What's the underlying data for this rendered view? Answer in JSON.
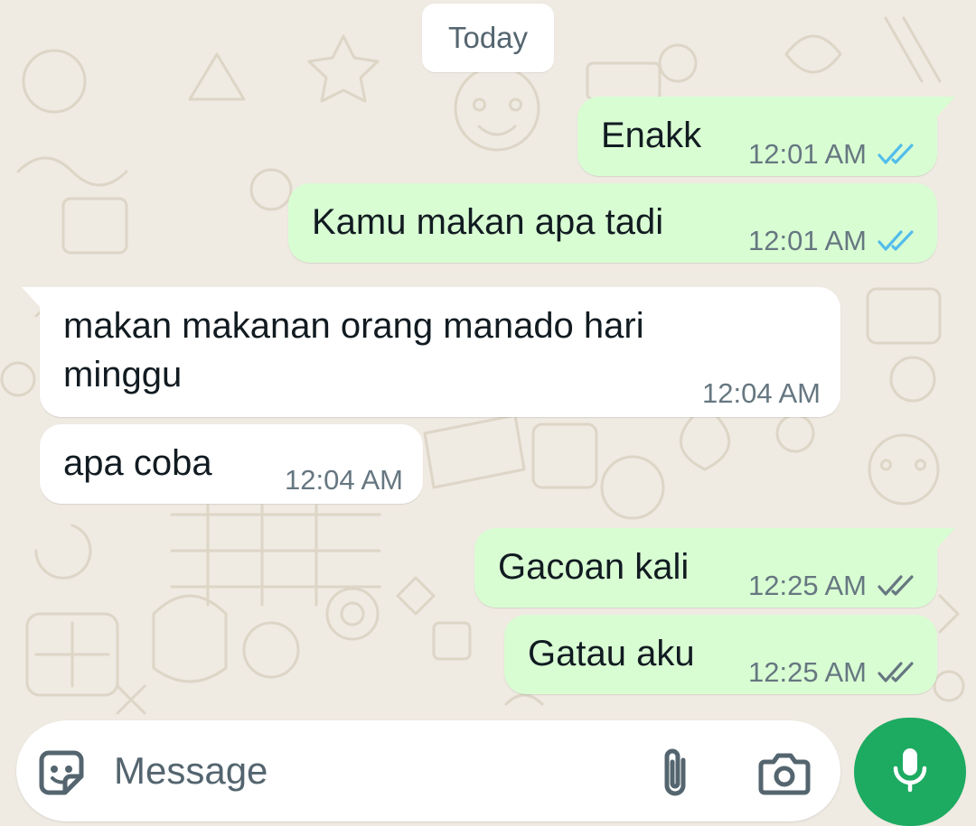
{
  "chat": {
    "date_label": "Today",
    "messages": [
      {
        "direction": "outgoing",
        "text": "Enakk",
        "time": "12:01 AM",
        "status": "read"
      },
      {
        "direction": "outgoing",
        "text": "Kamu makan apa tadi",
        "time": "12:01 AM",
        "status": "read"
      },
      {
        "direction": "incoming",
        "text_line1": "makan makanan orang manado hari",
        "text_line2": "minggu",
        "time": "12:04 AM"
      },
      {
        "direction": "incoming",
        "text": "apa coba",
        "time": "12:04 AM"
      },
      {
        "direction": "outgoing",
        "text": "Gacoan kali",
        "time": "12:25 AM",
        "status": "delivered"
      },
      {
        "direction": "outgoing",
        "text": "Gatau aku",
        "time": "12:25 AM",
        "status": "delivered"
      }
    ]
  },
  "input": {
    "placeholder": "Message",
    "emoji_icon": "sticker-smile-icon",
    "attach_icon": "paperclip-icon",
    "camera_icon": "camera-icon",
    "mic_icon": "microphone-icon"
  },
  "colors": {
    "background": "#efeae2",
    "outgoing_bubble": "#d9fdd3",
    "incoming_bubble": "#ffffff",
    "read_tick": "#53bdeb",
    "delivered_tick": "#667781",
    "mic_button": "#1daa61"
  }
}
